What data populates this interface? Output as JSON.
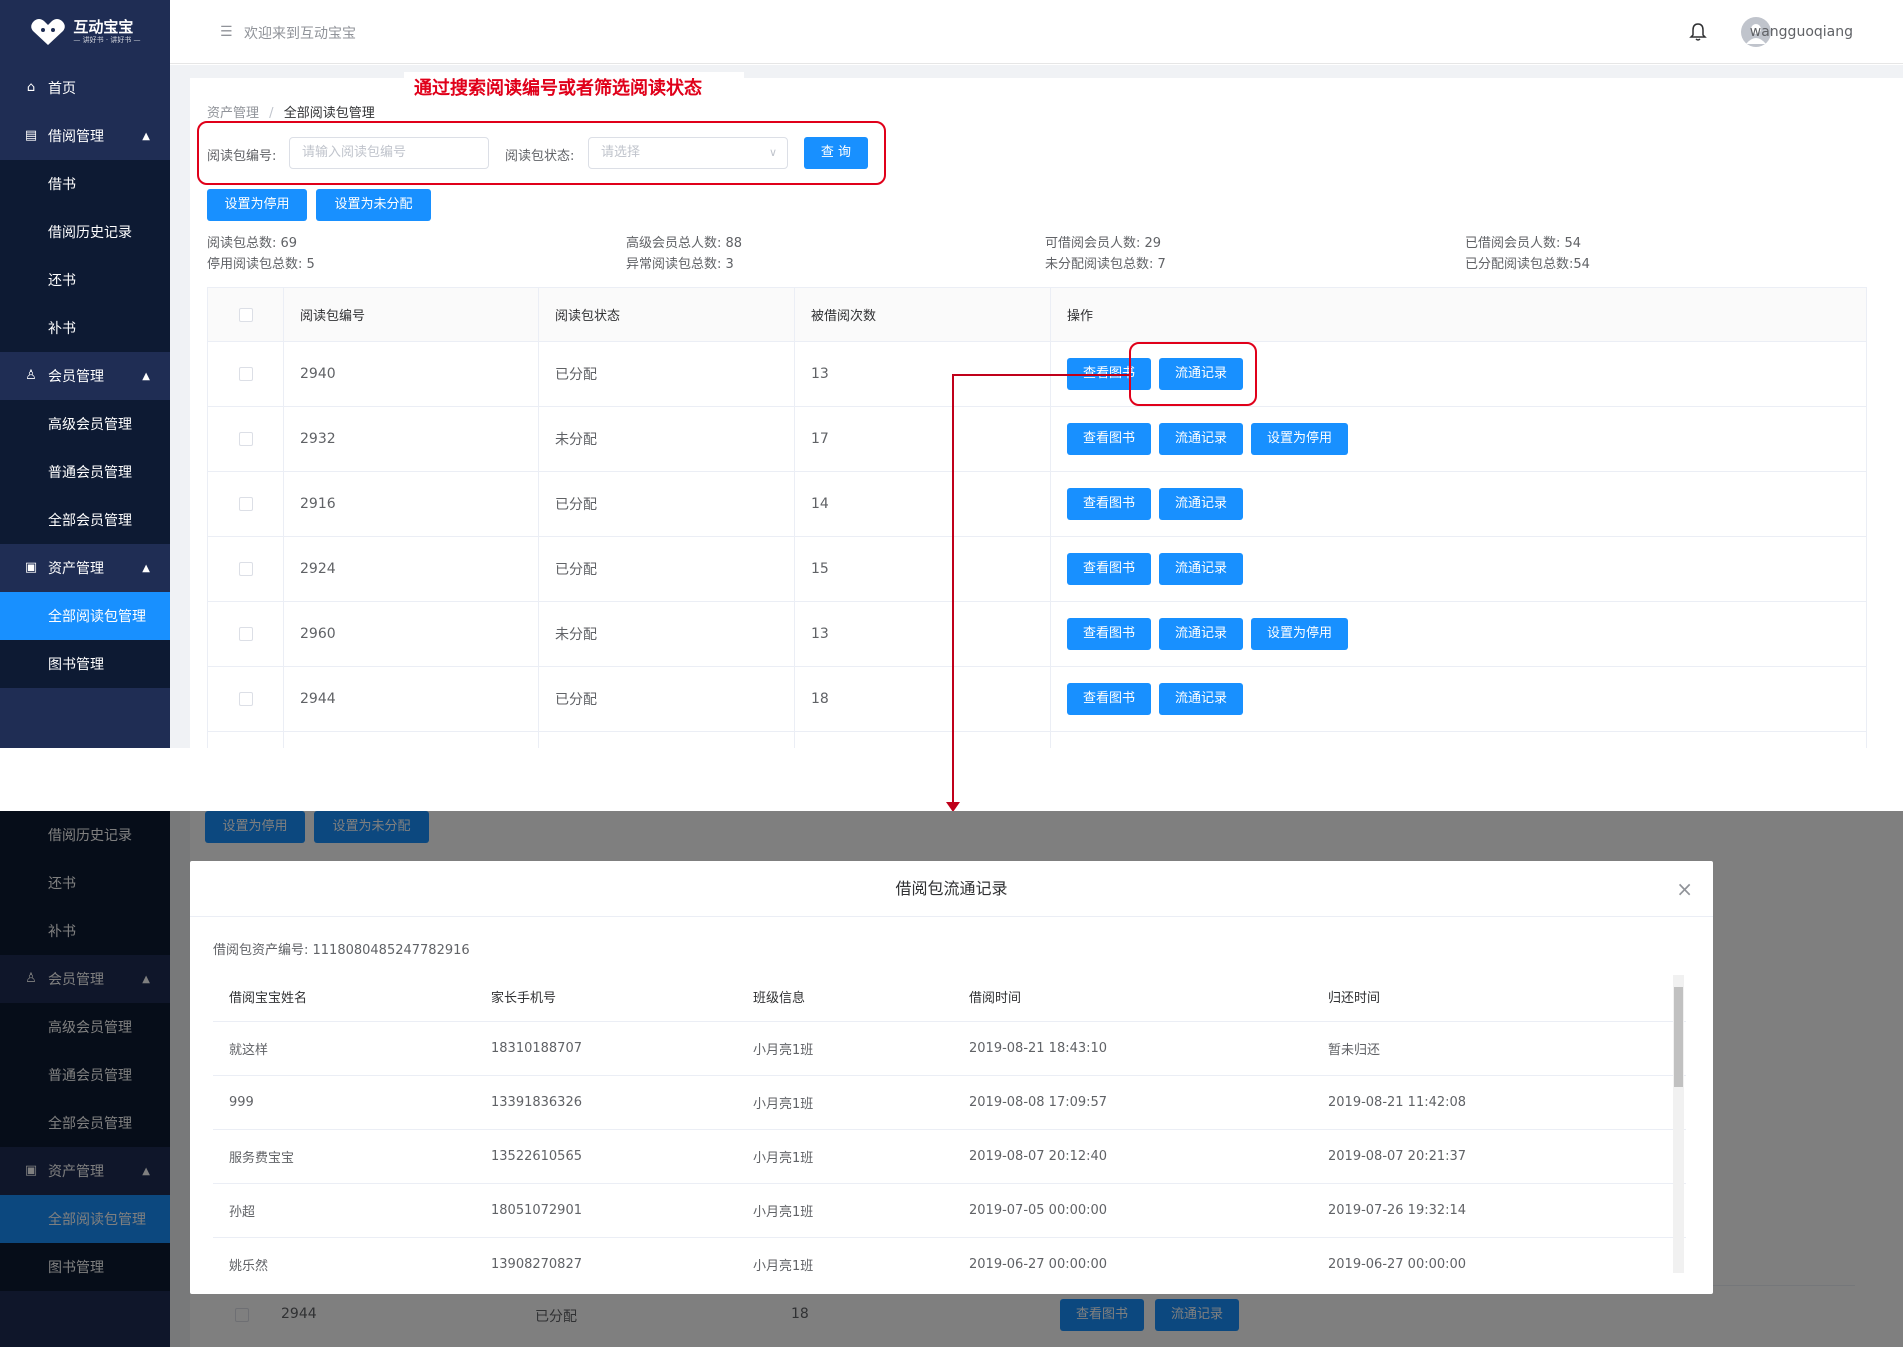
{
  "annotation": "通过搜索阅读编号或者筛选阅读状态",
  "app": {
    "logo_text": "互动宝宝",
    "logo_sub": "— 讲好书 · 讲好书 —",
    "welcome": "欢迎来到互动宝宝",
    "username": "wangguoqiang"
  },
  "sidebar": {
    "home": "首页",
    "borrow_group": "借阅管理",
    "borrow_items": [
      "借书",
      "借阅历史记录",
      "还书",
      "补书"
    ],
    "member_group": "会员管理",
    "member_items": [
      "高级会员管理",
      "普通会员管理",
      "全部会员管理"
    ],
    "asset_group": "资产管理",
    "asset_items": [
      "全部阅读包管理",
      "图书管理"
    ]
  },
  "breadcrumb": {
    "parent": "资产管理",
    "separator": "/",
    "current": "全部阅读包管理"
  },
  "search": {
    "id_label": "阅读包编号:",
    "id_placeholder": "请输入阅读包编号",
    "status_label": "阅读包状态:",
    "status_placeholder": "请选择",
    "query_button": "查 询"
  },
  "actions": {
    "disable": "设置为停用",
    "unassign": "设置为未分配"
  },
  "stats": {
    "total": "阅读包总数: 69",
    "disabled": "停用阅读包总数: 5",
    "premium": "高级会员总人数: 88",
    "abnormal": "异常阅读包总数: 3",
    "borrowable": "可借阅会员人数: 29",
    "unassigned": "未分配阅读包总数: 7",
    "borrowed": "已借阅会员人数: 54",
    "assigned": "已分配阅读包总数:54"
  },
  "table": {
    "headers": [
      "阅读包编号",
      "阅读包状态",
      "被借阅次数",
      "操作"
    ],
    "btn_view": "查看图书",
    "btn_record": "流通记录",
    "btn_disable": "设置为停用",
    "rows": [
      {
        "id": "2940",
        "status": "已分配",
        "count": "13"
      },
      {
        "id": "2932",
        "status": "未分配",
        "count": "17"
      },
      {
        "id": "2916",
        "status": "已分配",
        "count": "14"
      },
      {
        "id": "2924",
        "status": "已分配",
        "count": "15"
      },
      {
        "id": "2960",
        "status": "未分配",
        "count": "13"
      },
      {
        "id": "2944",
        "status": "已分配",
        "count": "18"
      }
    ]
  },
  "bottom_bg": {
    "row_id": "2944",
    "row_status": "已分配",
    "row_count": "18"
  },
  "modal": {
    "title": "借阅包流通记录",
    "close": "×",
    "asset_label": "借阅包资产编号: 1118080485247782916",
    "headers": [
      "借阅宝宝姓名",
      "家长手机号",
      "班级信息",
      "借阅时间",
      "归还时间"
    ],
    "rows": [
      [
        "就这样",
        "18310188707",
        "小月亮1班",
        "2019-08-21 18:43:10",
        "暂未归还"
      ],
      [
        "999",
        "13391836326",
        "小月亮1班",
        "2019-08-08 17:09:57",
        "2019-08-21 11:42:08"
      ],
      [
        "服务费宝宝",
        "13522610565",
        "小月亮1班",
        "2019-08-07 20:12:40",
        "2019-08-07 20:21:37"
      ],
      [
        "孙超",
        "18051072901",
        "小月亮1班",
        "2019-07-05 00:00:00",
        "2019-07-26 19:32:14"
      ],
      [
        "姚乐然",
        "13908270827",
        "小月亮1班",
        "2019-06-27 00:00:00",
        "2019-06-27 00:00:00"
      ]
    ]
  },
  "colors": {
    "sidebar": "#1f2d54",
    "submenu": "#0d1a33",
    "primary": "#1890ff",
    "annotation_red": "#e0001a"
  }
}
